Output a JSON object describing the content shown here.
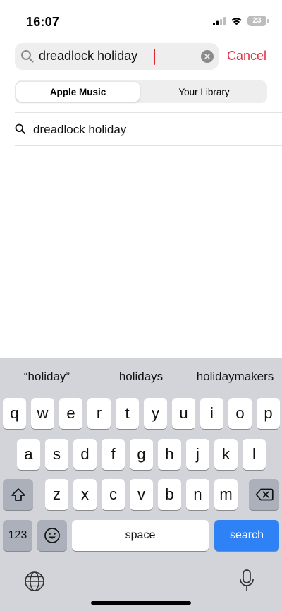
{
  "status_bar": {
    "time": "16:07",
    "battery": "23"
  },
  "search": {
    "query": "dreadlock holiday",
    "cancel_label": "Cancel"
  },
  "scope": {
    "tabs": [
      "Apple Music",
      "Your Library"
    ],
    "selected": "Apple Music"
  },
  "suggestions": [
    "dreadlock holiday"
  ],
  "keyboard": {
    "predictions": [
      "“holiday”",
      "holidays",
      "holidaymakers"
    ],
    "row1": [
      "q",
      "w",
      "e",
      "r",
      "t",
      "y",
      "u",
      "i",
      "o",
      "p"
    ],
    "row2": [
      "a",
      "s",
      "d",
      "f",
      "g",
      "h",
      "j",
      "k",
      "l"
    ],
    "row3": [
      "z",
      "x",
      "c",
      "v",
      "b",
      "n",
      "m"
    ],
    "numbers_label": "123",
    "space_label": "space",
    "return_label": "search"
  },
  "colors": {
    "accent": "#e53245",
    "caret": "#e0262f",
    "search_key": "#2e82f6",
    "keyboard_bg": "#d2d4d9"
  },
  "icons": [
    "search-icon",
    "clear-icon",
    "shift-icon",
    "backspace-icon",
    "emoji-icon",
    "globe-icon",
    "microphone-icon"
  ]
}
